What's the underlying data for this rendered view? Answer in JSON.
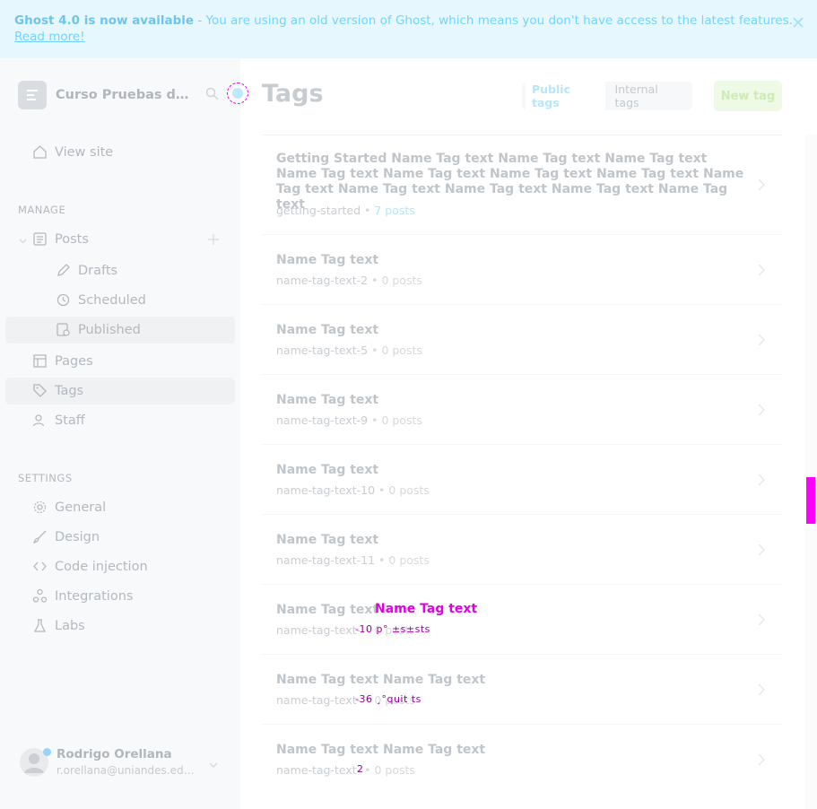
{
  "banner": {
    "bold": "Ghost 4.0 is now available",
    "text": " - You are using an old version of Ghost, which means you don't have access to the latest features.",
    "link": "Read more!",
    "close_icon": "close-icon"
  },
  "sidebar": {
    "brand": "Curso Pruebas de Software",
    "view_site": "View site",
    "manage_label": "MANAGE",
    "posts": "Posts",
    "drafts": "Drafts",
    "scheduled": "Scheduled",
    "published": "Published",
    "pages": "Pages",
    "tags": "Tags",
    "staff": "Staff",
    "settings_label": "SETTINGS",
    "general": "General",
    "design": "Design",
    "code_injection": "Code injection",
    "integrations": "Integrations",
    "labs": "Labs"
  },
  "user": {
    "name": "Rodrigo Orellana",
    "email": "r.orellana@uniandes.edu.co"
  },
  "header": {
    "title": "Tags",
    "tab_public": "Public tags",
    "tab_internal": "Internal tags",
    "new_tag": "New tag"
  },
  "tags": [
    {
      "title": "Getting Started Name Tag text Name Tag text Name Tag text Name Tag text Name Tag text Name Tag text Name Tag text Name Tag text Name Tag text Name Tag text Name Tag text Name Tag text",
      "slug": "getting-started",
      "count": "7 posts"
    },
    {
      "title": "Name Tag text",
      "slug": "name-tag-text-2",
      "count": "0 posts"
    },
    {
      "title": "Name Tag text",
      "slug": "name-tag-text-5",
      "count": "0 posts"
    },
    {
      "title": "Name Tag text",
      "slug": "name-tag-text-9",
      "count": "0 posts"
    },
    {
      "title": "Name Tag text",
      "slug": "name-tag-text-10",
      "count": "0 posts"
    },
    {
      "title": "Name Tag text",
      "slug": "name-tag-text-11",
      "count": "0 posts"
    },
    {
      "title": "Name Tag text",
      "slug": "name-tag-text-",
      "count": "0 posts"
    },
    {
      "title": "Name Tag text Name Tag text",
      "slug": "name-tag-text-",
      "count": "0 posts"
    },
    {
      "title": "Name Tag text Name Tag text",
      "slug": "name-tag-text-",
      "count": "0 posts"
    }
  ],
  "overlays": {
    "row7_title": "Name Tag text",
    "row7_sub": "-10 p° ±s±sts",
    "row8_sub": "-36 ¸°quit ts",
    "row9_sub": "2"
  }
}
